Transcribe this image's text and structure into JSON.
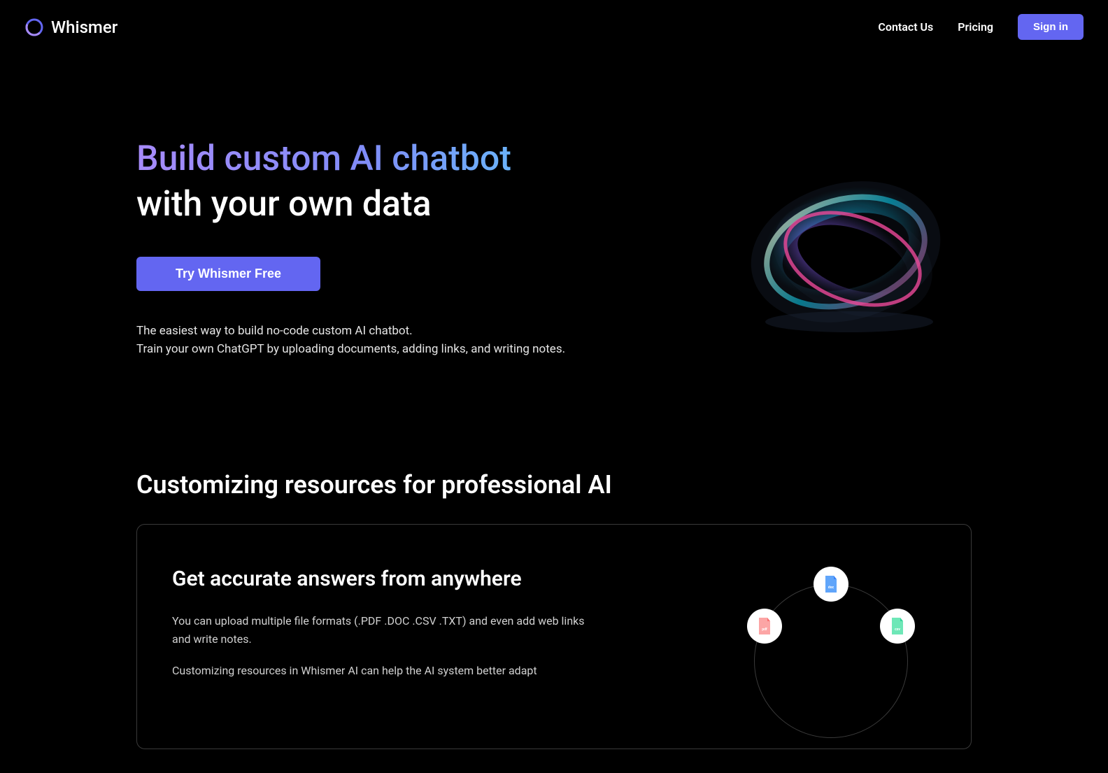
{
  "header": {
    "logo_text": "Whismer",
    "nav": {
      "contact": "Contact Us",
      "pricing": "Pricing",
      "signin": "Sign in"
    }
  },
  "hero": {
    "title_gradient": "Build custom AI chatbot",
    "title_white": "with your own data",
    "cta_button": "Try Whismer Free",
    "description_line1": "The easiest way to build no-code custom AI chatbot.",
    "description_line2": "Train your own ChatGPT by uploading documents, adding links, and writing notes."
  },
  "section2": {
    "title": "Customizing resources for professional AI",
    "card": {
      "title": "Get accurate answers from anywhere",
      "text1": "You can upload multiple file formats (.PDF .DOC .CSV .TXT) and even add web links and write notes.",
      "text2": "Customizing resources in Whismer AI can help the AI system better adapt",
      "file_labels": {
        "doc": "doc",
        "pdf": "pdf",
        "csv": "csv"
      }
    }
  }
}
